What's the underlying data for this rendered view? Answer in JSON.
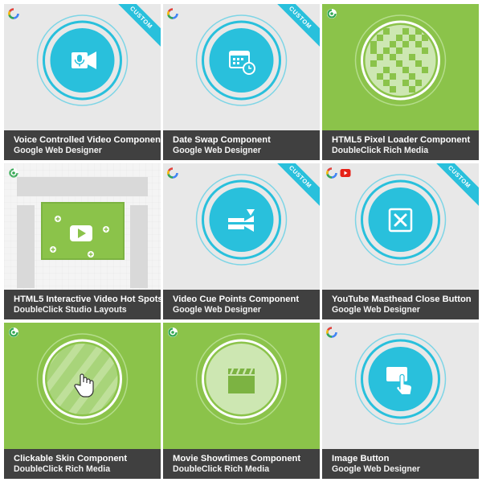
{
  "colors": {
    "accent_cyan": "#29c0dc",
    "brand_green": "#8bc34a",
    "caption_bg": "#404040",
    "card_gray": "#e8e8e8"
  },
  "cards": [
    {
      "title": "Voice Controlled Video Component",
      "subtitle": "Google Web Designer",
      "ribbon": "CUSTOM",
      "icon": "microphone-video-icon"
    },
    {
      "title": "Date Swap Component",
      "subtitle": "Google Web Designer",
      "ribbon": "CUSTOM",
      "icon": "calendar-clock-icon"
    },
    {
      "title": "HTML5 Pixel Loader Component",
      "subtitle": "DoubleClick Rich Media",
      "icon": "pixel-grid-icon"
    },
    {
      "title": "HTML5 Interactive Video Hot Spots",
      "subtitle": "DoubleClick Studio Layouts",
      "icon": "video-hotspots-icon"
    },
    {
      "title": "Video Cue Points Component",
      "subtitle": "Google Web Designer",
      "ribbon": "CUSTOM",
      "icon": "cue-points-icon"
    },
    {
      "title": "YouTube Masthead Close Button",
      "subtitle": "Google Web Designer",
      "ribbon": "CUSTOM",
      "icon": "close-box-icon"
    },
    {
      "title": "Clickable Skin Component",
      "subtitle": "DoubleClick Rich Media",
      "icon": "hand-cursor-icon"
    },
    {
      "title": "Movie Showtimes Component",
      "subtitle": "DoubleClick Rich Media",
      "icon": "clapperboard-icon"
    },
    {
      "title": "Image Button",
      "subtitle": "Google Web Designer",
      "icon": "touch-image-icon"
    }
  ]
}
